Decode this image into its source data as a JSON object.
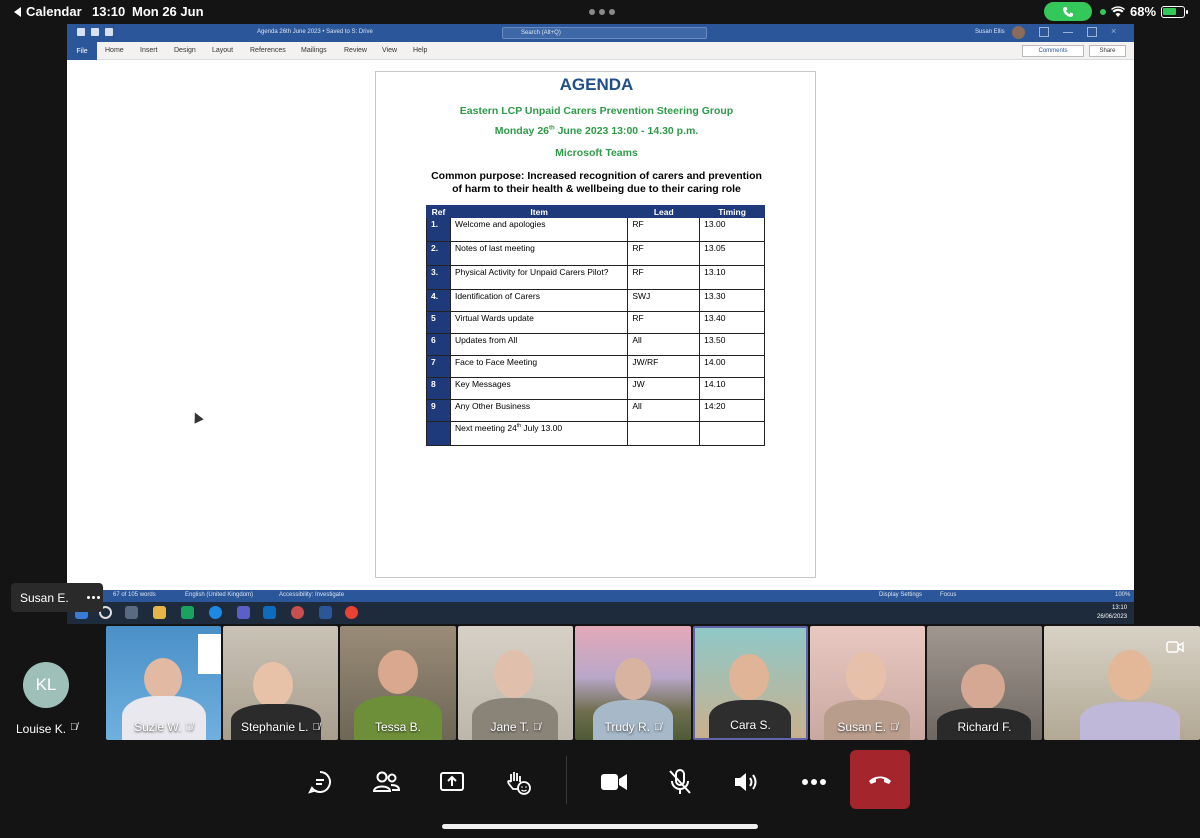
{
  "status_bar": {
    "back_label": "Calendar",
    "time": "13:10",
    "date": "Mon 26 Jun",
    "battery": "68%"
  },
  "word": {
    "doc_title": "Agenda 26th June 2023 • Saved to S: Drive",
    "search_placeholder": "Search (Alt+Q)",
    "user": "Susan Ellis",
    "menu": [
      "Home",
      "Insert",
      "Design",
      "Layout",
      "References",
      "Mailings",
      "Review",
      "View",
      "Help"
    ],
    "file_label": "File",
    "comments_label": "Comments",
    "share_label": "Share",
    "status": {
      "words": "67 of 105 words",
      "language": "English (United Kingdom)",
      "accessibility": "Accessibility: Investigate",
      "display_settings": "Display Settings",
      "focus": "Focus",
      "zoom": "100%"
    },
    "clock_time": "13:10",
    "clock_date": "26/06/2023"
  },
  "document": {
    "heading": "AGENDA",
    "group": "Eastern LCP Unpaid Carers Prevention Steering Group",
    "date_prefix": "Monday 26",
    "date_sup": "th",
    "date_suffix": " June 2023 13:00 - 14.30 p.m.",
    "platform": "Microsoft Teams",
    "purpose_line1": "Common purpose: Increased recognition of carers and prevention",
    "purpose_line2": "of harm to their health & wellbeing due to their caring role",
    "table_headers": [
      "Ref",
      "Item",
      "Lead",
      "Timing"
    ],
    "rows": [
      {
        "ref": "1.",
        "item": "Welcome and apologies",
        "lead": "RF",
        "timing": "13.00"
      },
      {
        "ref": "2.",
        "item": "Notes of last meeting",
        "lead": "RF",
        "timing": "13.05"
      },
      {
        "ref": "3.",
        "item": "Physical Activity for Unpaid Carers Pilot?",
        "lead": "RF",
        "timing": "13.10"
      },
      {
        "ref": "4.",
        "item": "Identification of Carers",
        "lead": "SWJ",
        "timing": "13.30"
      },
      {
        "ref": "5",
        "item": "Virtual Wards update",
        "lead": "RF",
        "timing": "13.40"
      },
      {
        "ref": "6",
        "item": "Updates from All",
        "lead": "All",
        "timing": "13.50"
      },
      {
        "ref": "7",
        "item": "Face to Face Meeting",
        "lead": "JW/RF",
        "timing": "14.00"
      },
      {
        "ref": "8",
        "item": "Key Messages",
        "lead": "JW",
        "timing": "14.10"
      },
      {
        "ref": "9",
        "item": "Any Other Business",
        "lead": "All",
        "timing": "14:20"
      }
    ],
    "next_meeting_prefix": "Next meeting  24",
    "next_meeting_sup": "th",
    "next_meeting_suffix": " July 13.00"
  },
  "presenter": {
    "name": "Susan E."
  },
  "participants": [
    {
      "initials": "KL",
      "name": "Louise K."
    },
    {
      "name": "Suzie W."
    },
    {
      "name": "Stephanie L."
    },
    {
      "name": "Tessa B."
    },
    {
      "name": "Jane T."
    },
    {
      "name": "Trudy R."
    },
    {
      "name": "Cara S."
    },
    {
      "name": "Susan E."
    },
    {
      "name": "Richard F."
    }
  ],
  "colors": {
    "leave_button": "#a4262c",
    "active_speaker": "#6264a7",
    "agenda_blue": "#1f4e89",
    "agenda_green": "#2e9b48",
    "table_header": "#1f3a7a"
  }
}
